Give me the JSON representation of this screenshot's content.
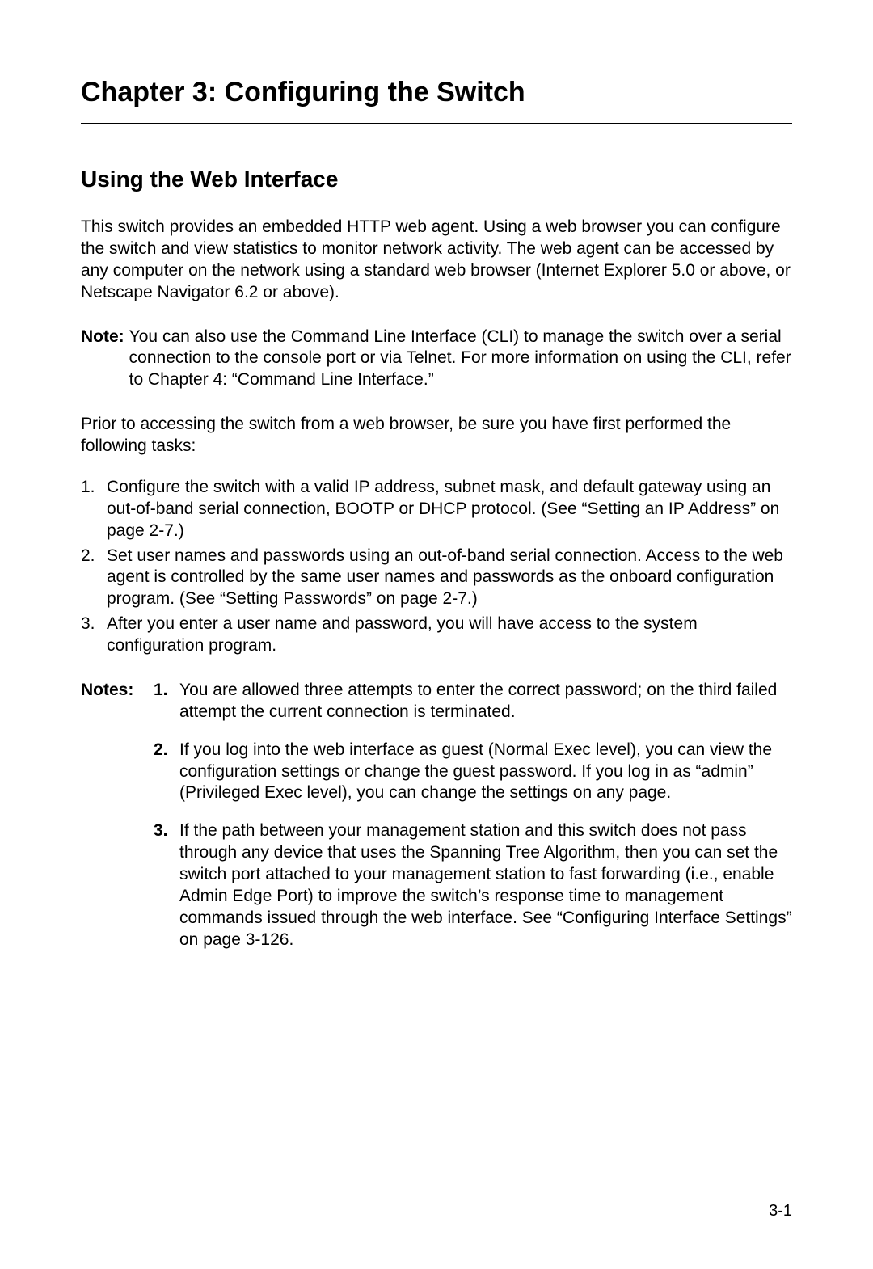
{
  "chapter_title": "Chapter 3: Configuring the Switch",
  "section_title": "Using the Web Interface",
  "intro_paragraph": "This switch provides an embedded HTTP web agent. Using a web browser you can configure the switch and view statistics to monitor network activity. The web agent can be accessed by any computer on the network using a standard web browser (Internet Explorer 5.0 or above, or Netscape Navigator 6.2 or above).",
  "note_label": "Note:",
  "note_text": "You can also use the Command Line Interface (CLI) to manage the switch over a serial connection to the console port or via Telnet. For more information on using the CLI, refer to Chapter 4: “Command Line Interface.”",
  "prior_paragraph": "Prior to accessing the switch from a web browser, be sure you have first performed the following tasks:",
  "tasks": [
    {
      "num": "1.",
      "text": "Configure the switch with a valid IP address, subnet mask, and default gateway using an out-of-band serial connection, BOOTP or DHCP protocol. (See “Setting an IP Address” on page 2-7.)"
    },
    {
      "num": "2.",
      "text": "Set user names and passwords using an out-of-band serial connection. Access to the web agent is controlled by the same user names and passwords as the onboard configuration program. (See “Setting Passwords” on page 2-7.)"
    },
    {
      "num": "3.",
      "text": "After you enter a user name and password, you will have access to the system configuration program."
    }
  ],
  "notes_label": "Notes:",
  "notes": [
    {
      "num": "1.",
      "text": "You are allowed three attempts to enter the correct password; on the third failed attempt the current connection is terminated."
    },
    {
      "num": "2.",
      "text": "If you log into the web interface as guest (Normal Exec level), you can view the configuration settings or change the guest password. If you log in as “admin” (Privileged Exec level), you can change the settings on any page."
    },
    {
      "num": "3.",
      "text": "If the path between your management station and this switch does not pass through any device that uses the Spanning Tree Algorithm, then you can set the switch port attached to your management station to fast forwarding (i.e., enable Admin Edge Port) to improve the switch’s response time to management commands issued through the web interface. See “Configuring Interface Settings” on page 3-126."
    }
  ],
  "page_number": "3-1"
}
